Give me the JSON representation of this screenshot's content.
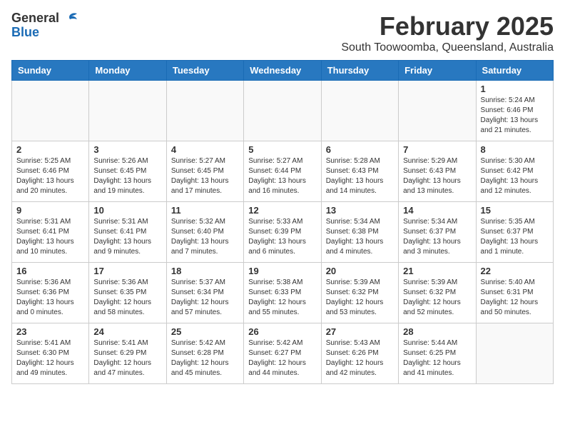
{
  "logo": {
    "general": "General",
    "blue": "Blue"
  },
  "header": {
    "title": "February 2025",
    "subtitle": "South Toowoomba, Queensland, Australia"
  },
  "weekdays": [
    "Sunday",
    "Monday",
    "Tuesday",
    "Wednesday",
    "Thursday",
    "Friday",
    "Saturday"
  ],
  "weeks": [
    [
      {
        "day": "",
        "info": ""
      },
      {
        "day": "",
        "info": ""
      },
      {
        "day": "",
        "info": ""
      },
      {
        "day": "",
        "info": ""
      },
      {
        "day": "",
        "info": ""
      },
      {
        "day": "",
        "info": ""
      },
      {
        "day": "1",
        "info": "Sunrise: 5:24 AM\nSunset: 6:46 PM\nDaylight: 13 hours\nand 21 minutes."
      }
    ],
    [
      {
        "day": "2",
        "info": "Sunrise: 5:25 AM\nSunset: 6:46 PM\nDaylight: 13 hours\nand 20 minutes."
      },
      {
        "day": "3",
        "info": "Sunrise: 5:26 AM\nSunset: 6:45 PM\nDaylight: 13 hours\nand 19 minutes."
      },
      {
        "day": "4",
        "info": "Sunrise: 5:27 AM\nSunset: 6:45 PM\nDaylight: 13 hours\nand 17 minutes."
      },
      {
        "day": "5",
        "info": "Sunrise: 5:27 AM\nSunset: 6:44 PM\nDaylight: 13 hours\nand 16 minutes."
      },
      {
        "day": "6",
        "info": "Sunrise: 5:28 AM\nSunset: 6:43 PM\nDaylight: 13 hours\nand 14 minutes."
      },
      {
        "day": "7",
        "info": "Sunrise: 5:29 AM\nSunset: 6:43 PM\nDaylight: 13 hours\nand 13 minutes."
      },
      {
        "day": "8",
        "info": "Sunrise: 5:30 AM\nSunset: 6:42 PM\nDaylight: 13 hours\nand 12 minutes."
      }
    ],
    [
      {
        "day": "9",
        "info": "Sunrise: 5:31 AM\nSunset: 6:41 PM\nDaylight: 13 hours\nand 10 minutes."
      },
      {
        "day": "10",
        "info": "Sunrise: 5:31 AM\nSunset: 6:41 PM\nDaylight: 13 hours\nand 9 minutes."
      },
      {
        "day": "11",
        "info": "Sunrise: 5:32 AM\nSunset: 6:40 PM\nDaylight: 13 hours\nand 7 minutes."
      },
      {
        "day": "12",
        "info": "Sunrise: 5:33 AM\nSunset: 6:39 PM\nDaylight: 13 hours\nand 6 minutes."
      },
      {
        "day": "13",
        "info": "Sunrise: 5:34 AM\nSunset: 6:38 PM\nDaylight: 13 hours\nand 4 minutes."
      },
      {
        "day": "14",
        "info": "Sunrise: 5:34 AM\nSunset: 6:37 PM\nDaylight: 13 hours\nand 3 minutes."
      },
      {
        "day": "15",
        "info": "Sunrise: 5:35 AM\nSunset: 6:37 PM\nDaylight: 13 hours\nand 1 minute."
      }
    ],
    [
      {
        "day": "16",
        "info": "Sunrise: 5:36 AM\nSunset: 6:36 PM\nDaylight: 13 hours\nand 0 minutes."
      },
      {
        "day": "17",
        "info": "Sunrise: 5:36 AM\nSunset: 6:35 PM\nDaylight: 12 hours\nand 58 minutes."
      },
      {
        "day": "18",
        "info": "Sunrise: 5:37 AM\nSunset: 6:34 PM\nDaylight: 12 hours\nand 57 minutes."
      },
      {
        "day": "19",
        "info": "Sunrise: 5:38 AM\nSunset: 6:33 PM\nDaylight: 12 hours\nand 55 minutes."
      },
      {
        "day": "20",
        "info": "Sunrise: 5:39 AM\nSunset: 6:32 PM\nDaylight: 12 hours\nand 53 minutes."
      },
      {
        "day": "21",
        "info": "Sunrise: 5:39 AM\nSunset: 6:32 PM\nDaylight: 12 hours\nand 52 minutes."
      },
      {
        "day": "22",
        "info": "Sunrise: 5:40 AM\nSunset: 6:31 PM\nDaylight: 12 hours\nand 50 minutes."
      }
    ],
    [
      {
        "day": "23",
        "info": "Sunrise: 5:41 AM\nSunset: 6:30 PM\nDaylight: 12 hours\nand 49 minutes."
      },
      {
        "day": "24",
        "info": "Sunrise: 5:41 AM\nSunset: 6:29 PM\nDaylight: 12 hours\nand 47 minutes."
      },
      {
        "day": "25",
        "info": "Sunrise: 5:42 AM\nSunset: 6:28 PM\nDaylight: 12 hours\nand 45 minutes."
      },
      {
        "day": "26",
        "info": "Sunrise: 5:42 AM\nSunset: 6:27 PM\nDaylight: 12 hours\nand 44 minutes."
      },
      {
        "day": "27",
        "info": "Sunrise: 5:43 AM\nSunset: 6:26 PM\nDaylight: 12 hours\nand 42 minutes."
      },
      {
        "day": "28",
        "info": "Sunrise: 5:44 AM\nSunset: 6:25 PM\nDaylight: 12 hours\nand 41 minutes."
      },
      {
        "day": "",
        "info": ""
      }
    ]
  ]
}
